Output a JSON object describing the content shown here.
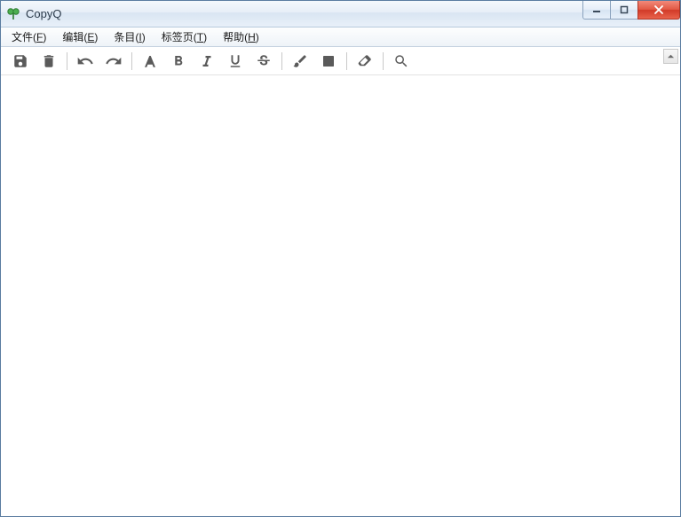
{
  "window": {
    "title": "CopyQ"
  },
  "menubar": {
    "items": [
      {
        "label": "文件",
        "mnemonic": "F"
      },
      {
        "label": "编辑",
        "mnemonic": "E"
      },
      {
        "label": "条目",
        "mnemonic": "I"
      },
      {
        "label": "标签页",
        "mnemonic": "T"
      },
      {
        "label": "帮助",
        "mnemonic": "H"
      }
    ]
  },
  "toolbar": {
    "groups": [
      [
        "save",
        "delete"
      ],
      [
        "undo",
        "redo"
      ],
      [
        "font",
        "bold",
        "italic",
        "underline",
        "strikethrough"
      ],
      [
        "foreground",
        "background"
      ],
      [
        "eraser"
      ],
      [
        "search"
      ]
    ],
    "icons": {
      "save": "save-icon",
      "delete": "trash-icon",
      "undo": "undo-icon",
      "redo": "redo-icon",
      "font": "font-icon",
      "bold": "bold-icon",
      "italic": "italic-icon",
      "underline": "underline-icon",
      "strikethrough": "strikethrough-icon",
      "foreground": "brush-icon",
      "background": "fill-square-icon",
      "eraser": "eraser-icon",
      "search": "search-icon"
    }
  }
}
